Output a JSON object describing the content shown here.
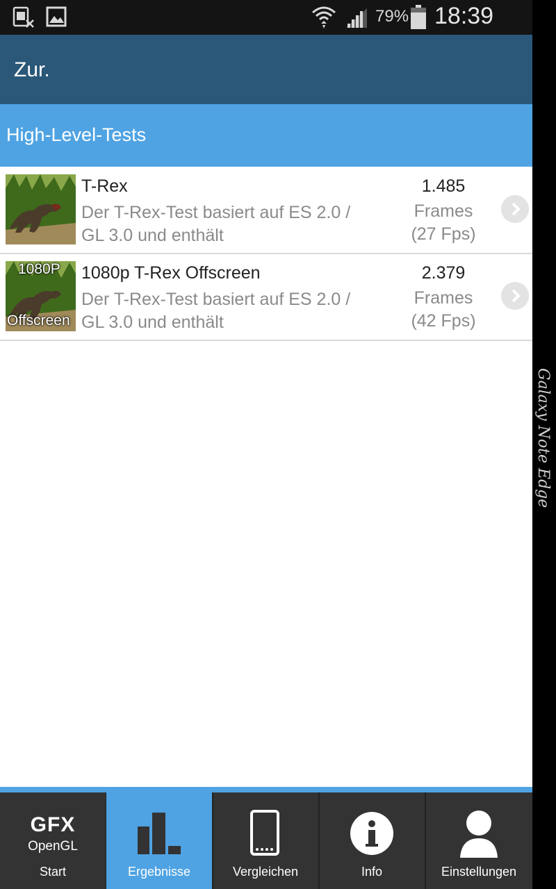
{
  "status_bar": {
    "battery_percent": "79%",
    "time": "18:39",
    "icons": [
      "sim-missing-icon",
      "image-notification-icon",
      "wifi-icon",
      "signal-icon",
      "battery-icon"
    ]
  },
  "app_bar": {
    "back_label": "Zur."
  },
  "section": {
    "title": "High-Level-Tests"
  },
  "tests": [
    {
      "name": "T-Rex",
      "description": "Der T-Rex-Test basiert auf ES 2.0 / GL 3.0 und enthält",
      "score": "1.485",
      "unit": "Frames",
      "fps": "(27 Fps)",
      "thumbnail_icon": "t-rex-thumbnail-icon"
    },
    {
      "name": "1080p T-Rex Offscreen",
      "description": "Der T-Rex-Test basiert auf ES 2.0 / GL 3.0 und enthält",
      "score": "2.379",
      "unit": "Frames",
      "fps": "(42 Fps)",
      "thumbnail_icon": "t-rex-offscreen-thumbnail-icon",
      "thumbnail_caption_top": "1080P",
      "thumbnail_caption_bottom": "Offscreen"
    }
  ],
  "edge_label": "Galaxy Note Edge",
  "bottom_nav": {
    "start": {
      "logo_top": "GFX",
      "logo_bottom": "OpenGL",
      "label": "Start"
    },
    "results": {
      "label": "Ergebnisse",
      "active": true
    },
    "compare": {
      "label": "Vergleichen"
    },
    "info": {
      "label": "Info"
    },
    "settings": {
      "label": "Einstellungen"
    }
  },
  "colors": {
    "app_bar": "#2b5778",
    "accent": "#4fa3e3",
    "nav_bg": "#333333"
  }
}
